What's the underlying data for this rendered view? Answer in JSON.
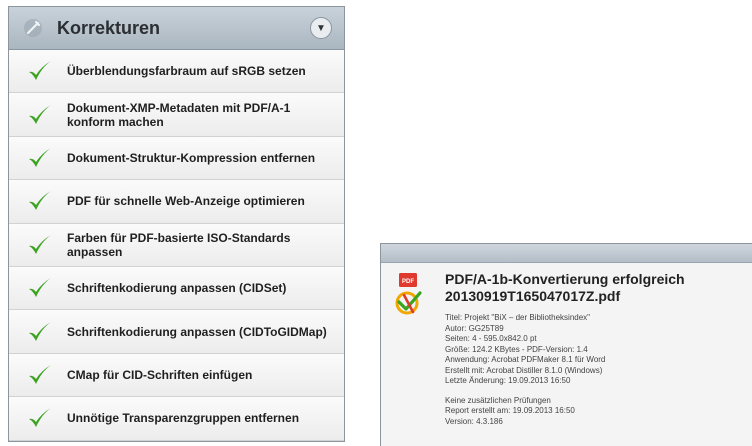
{
  "panel": {
    "title": "Korrekturen",
    "header_icon": "wrench-icon",
    "collapse_icon": "chevron-down-icon",
    "items": [
      {
        "label": "Überblendungsfarbraum auf sRGB setzen",
        "icon": "checkmark-icon"
      },
      {
        "label": "Dokument-XMP-Metadaten mit PDF/A-1 konform machen",
        "icon": "checkmark-icon"
      },
      {
        "label": "Dokument-Struktur-Kompression entfernen",
        "icon": "checkmark-icon"
      },
      {
        "label": "PDF für schnelle Web-Anzeige optimieren",
        "icon": "checkmark-icon"
      },
      {
        "label": "Farben für PDF-basierte ISO-Standards anpassen",
        "icon": "checkmark-icon"
      },
      {
        "label": "Schriftenkodierung anpassen (CIDSet)",
        "icon": "checkmark-icon"
      },
      {
        "label": "Schriftenkodierung anpassen (CIDToGIDMap)",
        "icon": "checkmark-icon"
      },
      {
        "label": "CMap für CID-Schriften einfügen",
        "icon": "checkmark-icon"
      },
      {
        "label": "Unnötige Transparenzgruppen entfernen",
        "icon": "checkmark-icon"
      }
    ],
    "colors": {
      "check_green": "#3aa31f",
      "header_bg": "#b8c3cc"
    }
  },
  "report": {
    "title_line1": "PDF/A-1b-Konvertierung erfolgreich",
    "title_line2": "20130919T165047017Z.pdf",
    "file_icon": "pdf-file-icon",
    "status_icon": "pdfa-logo-icon",
    "details": [
      "Titel: Projekt \"BiX – der Bibliotheksindex\"",
      "Autor: GG25T89",
      "Seiten: 4 - 595.0x842.0 pt",
      "Größe: 124.2 KBytes - PDF-Version: 1.4",
      "Anwendung: Acrobat PDFMaker 8.1 für Word",
      "Erstellt mit: Acrobat Distiller 8.1.0 (Windows)",
      "Letzte Änderung: 19.09.2013 16:50"
    ],
    "extra": [
      "Keine zusätzlichen Prüfungen",
      "Report erstellt am: 19.09.2013 16:50",
      "Version: 4.3.186"
    ]
  }
}
